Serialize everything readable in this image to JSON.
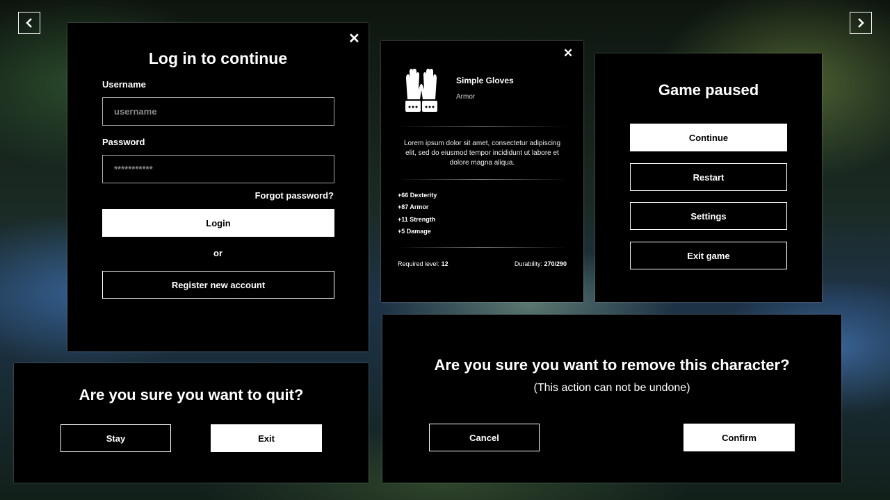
{
  "nav": {
    "prev_icon": "chevron-left-icon",
    "next_icon": "chevron-right-icon"
  },
  "login": {
    "title": "Log in to continue",
    "username_label": "Username",
    "username_placeholder": "username",
    "password_label": "Password",
    "password_value": "***********",
    "forgot": "Forgot password?",
    "login_button": "Login",
    "or": "or",
    "register_button": "Register new account"
  },
  "item": {
    "name": "Simple Gloves",
    "type": "Armor",
    "description": "Lorem ipsum dolor sit amet, consectetur adipiscing elit, sed do eiusmod tempor incididunt ut labore et dolore magna aliqua.",
    "stats": [
      "+66 Dexterity",
      "+87 Armor",
      "+11 Strength",
      "+5 Damage"
    ],
    "required_level_label": "Required level:",
    "required_level_value": "12",
    "durability_label": "Durability:",
    "durability_value": "270/290"
  },
  "pause": {
    "title": "Game paused",
    "buttons": [
      "Continue",
      "Restart",
      "Settings",
      "Exit game"
    ]
  },
  "quit": {
    "title": "Are you sure you want to quit?",
    "stay": "Stay",
    "exit": "Exit"
  },
  "remove": {
    "title": "Are you sure you want to remove this character?",
    "subtitle": "(This action can not be undone)",
    "cancel": "Cancel",
    "confirm": "Confirm"
  },
  "close_glyph": "✕"
}
